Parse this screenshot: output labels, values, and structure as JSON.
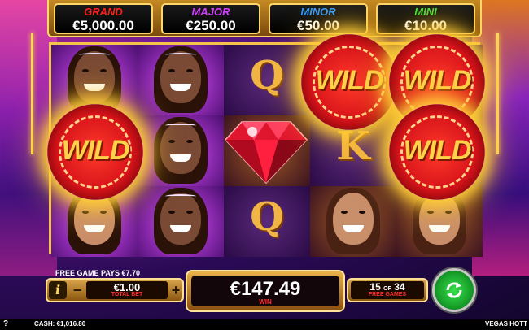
{
  "jackpots": [
    {
      "label": "GRAND",
      "value": "€5,000.00",
      "color": "#ff2020"
    },
    {
      "label": "MAJOR",
      "value": "€250.00",
      "color": "#d040ff"
    },
    {
      "label": "MINOR",
      "value": "€50.00",
      "color": "#2f9bff"
    },
    {
      "label": "MINI",
      "value": "€10.00",
      "color": "#3ee040"
    }
  ],
  "reels": {
    "symbols": [
      "woman-dark",
      "woman-dark",
      "Q",
      "wild",
      "wild",
      "wild",
      "woman-dark",
      "diamond",
      "K",
      "wild",
      "woman-dark",
      "woman-dark",
      "Q",
      "woman-brunette",
      "woman-brunette"
    ],
    "wild_label": "WILD",
    "q_label": "Q",
    "k_label": "K"
  },
  "bottom": {
    "free_game_pays": "FREE GAME PAYS €7.70",
    "info_label": "i",
    "minus_label": "−",
    "plus_label": "+",
    "bet_value": "€1.00",
    "bet_label": "TOTAL BET",
    "win_value": "€147.49",
    "win_label": "WIN",
    "free_games_current": "15",
    "free_games_of": "OF",
    "free_games_total": "34",
    "free_games_label": "FREE GAMES",
    "spin_icon": "refresh-icon"
  },
  "status_bar": {
    "help_label": "?",
    "cash": "CASH: €1,016.80",
    "game_name": "VEGAS HOTT"
  },
  "colors": {
    "spin_green": "#22c033",
    "chip_red": "#d8141a",
    "gold": "#f5c24a"
  }
}
